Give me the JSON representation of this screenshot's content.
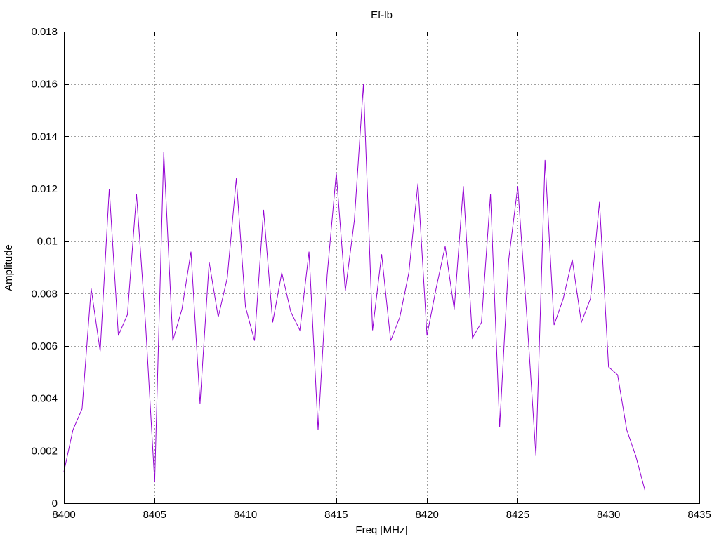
{
  "chart_data": {
    "type": "line",
    "title": "Ef-lb",
    "xlabel": "Freq [MHz]",
    "ylabel": "Amplitude",
    "xlim": [
      8400,
      8435
    ],
    "ylim": [
      0,
      0.018
    ],
    "xticks": [
      8400,
      8405,
      8410,
      8415,
      8420,
      8425,
      8430,
      8435
    ],
    "xtick_labels": [
      "8400",
      "8405",
      "8410",
      "8415",
      "8420",
      "8425",
      "8430",
      "8435"
    ],
    "yticks": [
      0,
      0.002,
      0.004,
      0.006,
      0.008,
      0.01,
      0.012,
      0.014,
      0.016,
      0.018
    ],
    "ytick_labels": [
      "0",
      "0.002",
      "0.004",
      "0.006",
      "0.008",
      "0.01",
      "0.012",
      "0.014",
      "0.016",
      "0.018"
    ],
    "grid": true,
    "line_color": "#9400d3",
    "series": [
      {
        "x": [
          8400.0,
          8400.5,
          8401.0,
          8401.5,
          8402.0,
          8402.5,
          8403.0,
          8403.5,
          8404.0,
          8404.5,
          8405.0,
          8405.5,
          8406.0,
          8406.5,
          8407.0,
          8407.5,
          8408.0,
          8408.5,
          8409.0,
          8409.5,
          8410.0,
          8410.5,
          8411.0,
          8411.5,
          8412.0,
          8412.5,
          8413.0,
          8413.5,
          8414.0,
          8414.5,
          8415.0,
          8415.5,
          8416.0,
          8416.5,
          8417.0,
          8417.5,
          8418.0,
          8418.5,
          8419.0,
          8419.5,
          8420.0,
          8420.5,
          8421.0,
          8421.5,
          8422.0,
          8422.5,
          8423.0,
          8423.5,
          8424.0,
          8424.5,
          8425.0,
          8425.5,
          8426.0,
          8426.5,
          8427.0,
          8427.5,
          8428.0,
          8428.5,
          8429.0,
          8429.5,
          8430.0,
          8430.5,
          8431.0,
          8431.5,
          8432.0
        ],
        "y": [
          0.0012,
          0.0028,
          0.0036,
          0.0082,
          0.0058,
          0.012,
          0.0064,
          0.0072,
          0.0118,
          0.0068,
          0.0008,
          0.0134,
          0.0062,
          0.0074,
          0.0096,
          0.0038,
          0.0092,
          0.0071,
          0.0086,
          0.0124,
          0.0075,
          0.0062,
          0.0112,
          0.0069,
          0.0088,
          0.0073,
          0.0066,
          0.0096,
          0.0028,
          0.0087,
          0.0126,
          0.0081,
          0.0108,
          0.016,
          0.0066,
          0.0095,
          0.0062,
          0.0071,
          0.0088,
          0.0122,
          0.0064,
          0.0082,
          0.0098,
          0.0074,
          0.0121,
          0.0063,
          0.0069,
          0.0118,
          0.0029,
          0.0093,
          0.0121,
          0.0071,
          0.0018,
          0.0131,
          0.0068,
          0.0078,
          0.0093,
          0.0069,
          0.0078,
          0.0115,
          0.0052,
          0.0049,
          0.0028,
          0.0018,
          0.0005
        ]
      }
    ]
  }
}
